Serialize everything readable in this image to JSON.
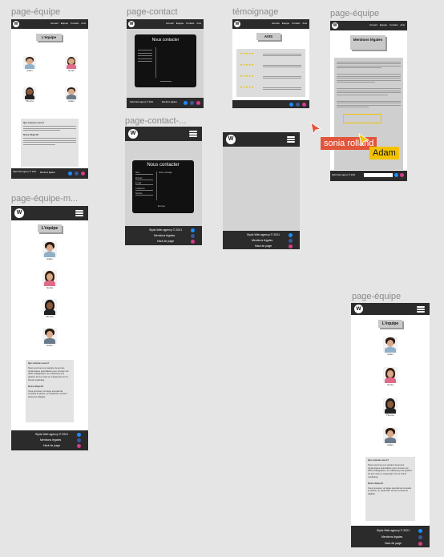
{
  "labels": {
    "page_equipe_1": "page-équipe",
    "page_contact": "page-contact",
    "temoignage": "témoignage",
    "page_equipe_2": "page-équipe",
    "page_contact_mobile": "page-contact-...",
    "page_equipe_mobile": "page-équipe-m...",
    "page_equipe_3": "page-équipe"
  },
  "logo": "W",
  "nav_links": [
    "Accueil",
    "Equipe",
    "Contact",
    "Avis"
  ],
  "titles": {
    "equipe": "L'équipe",
    "contact": "Nous contacter",
    "avis": "AVIS",
    "mentions": "Mentions légales"
  },
  "team": [
    "Adam",
    "Sonia",
    "Tiburce",
    "Adam"
  ],
  "mobile_team": [
    "Adam",
    "Sonia",
    "Tiburce",
    "Adam"
  ],
  "about": {
    "q1": "Qui sommes-nous?",
    "p1": "Nous sommes une équipe de jeunes dynamiques spécialisés pour rénover les défis stratégiques, du marketing à la gestion de leur web en s'appuyant sur le brand marketing.",
    "q2": "Notre Objectif:",
    "p2": "Vous proposer un large éventail de conseils et pistes, en particulier via leur présence digitale."
  },
  "contact_form": {
    "fields": [
      "Nom",
      "Prénom",
      "E-mail",
      "Téléphone",
      "Société"
    ],
    "message": "Votre message",
    "submit": "Envoyer"
  },
  "footer": {
    "agency": "Stylis Web agency © 2021",
    "mentions": "Mentions légales",
    "top": "Haut de page"
  },
  "collaborators": [
    {
      "name": "sonia rolland",
      "color": "#e2553a"
    },
    {
      "name": "Adam",
      "color": "#f2c200"
    }
  ],
  "colors": {
    "dark": "#2b2b2b",
    "accent_blue": "#1a8cff",
    "accent_pink": "#d63a8a",
    "stars": "#e8c21a"
  }
}
